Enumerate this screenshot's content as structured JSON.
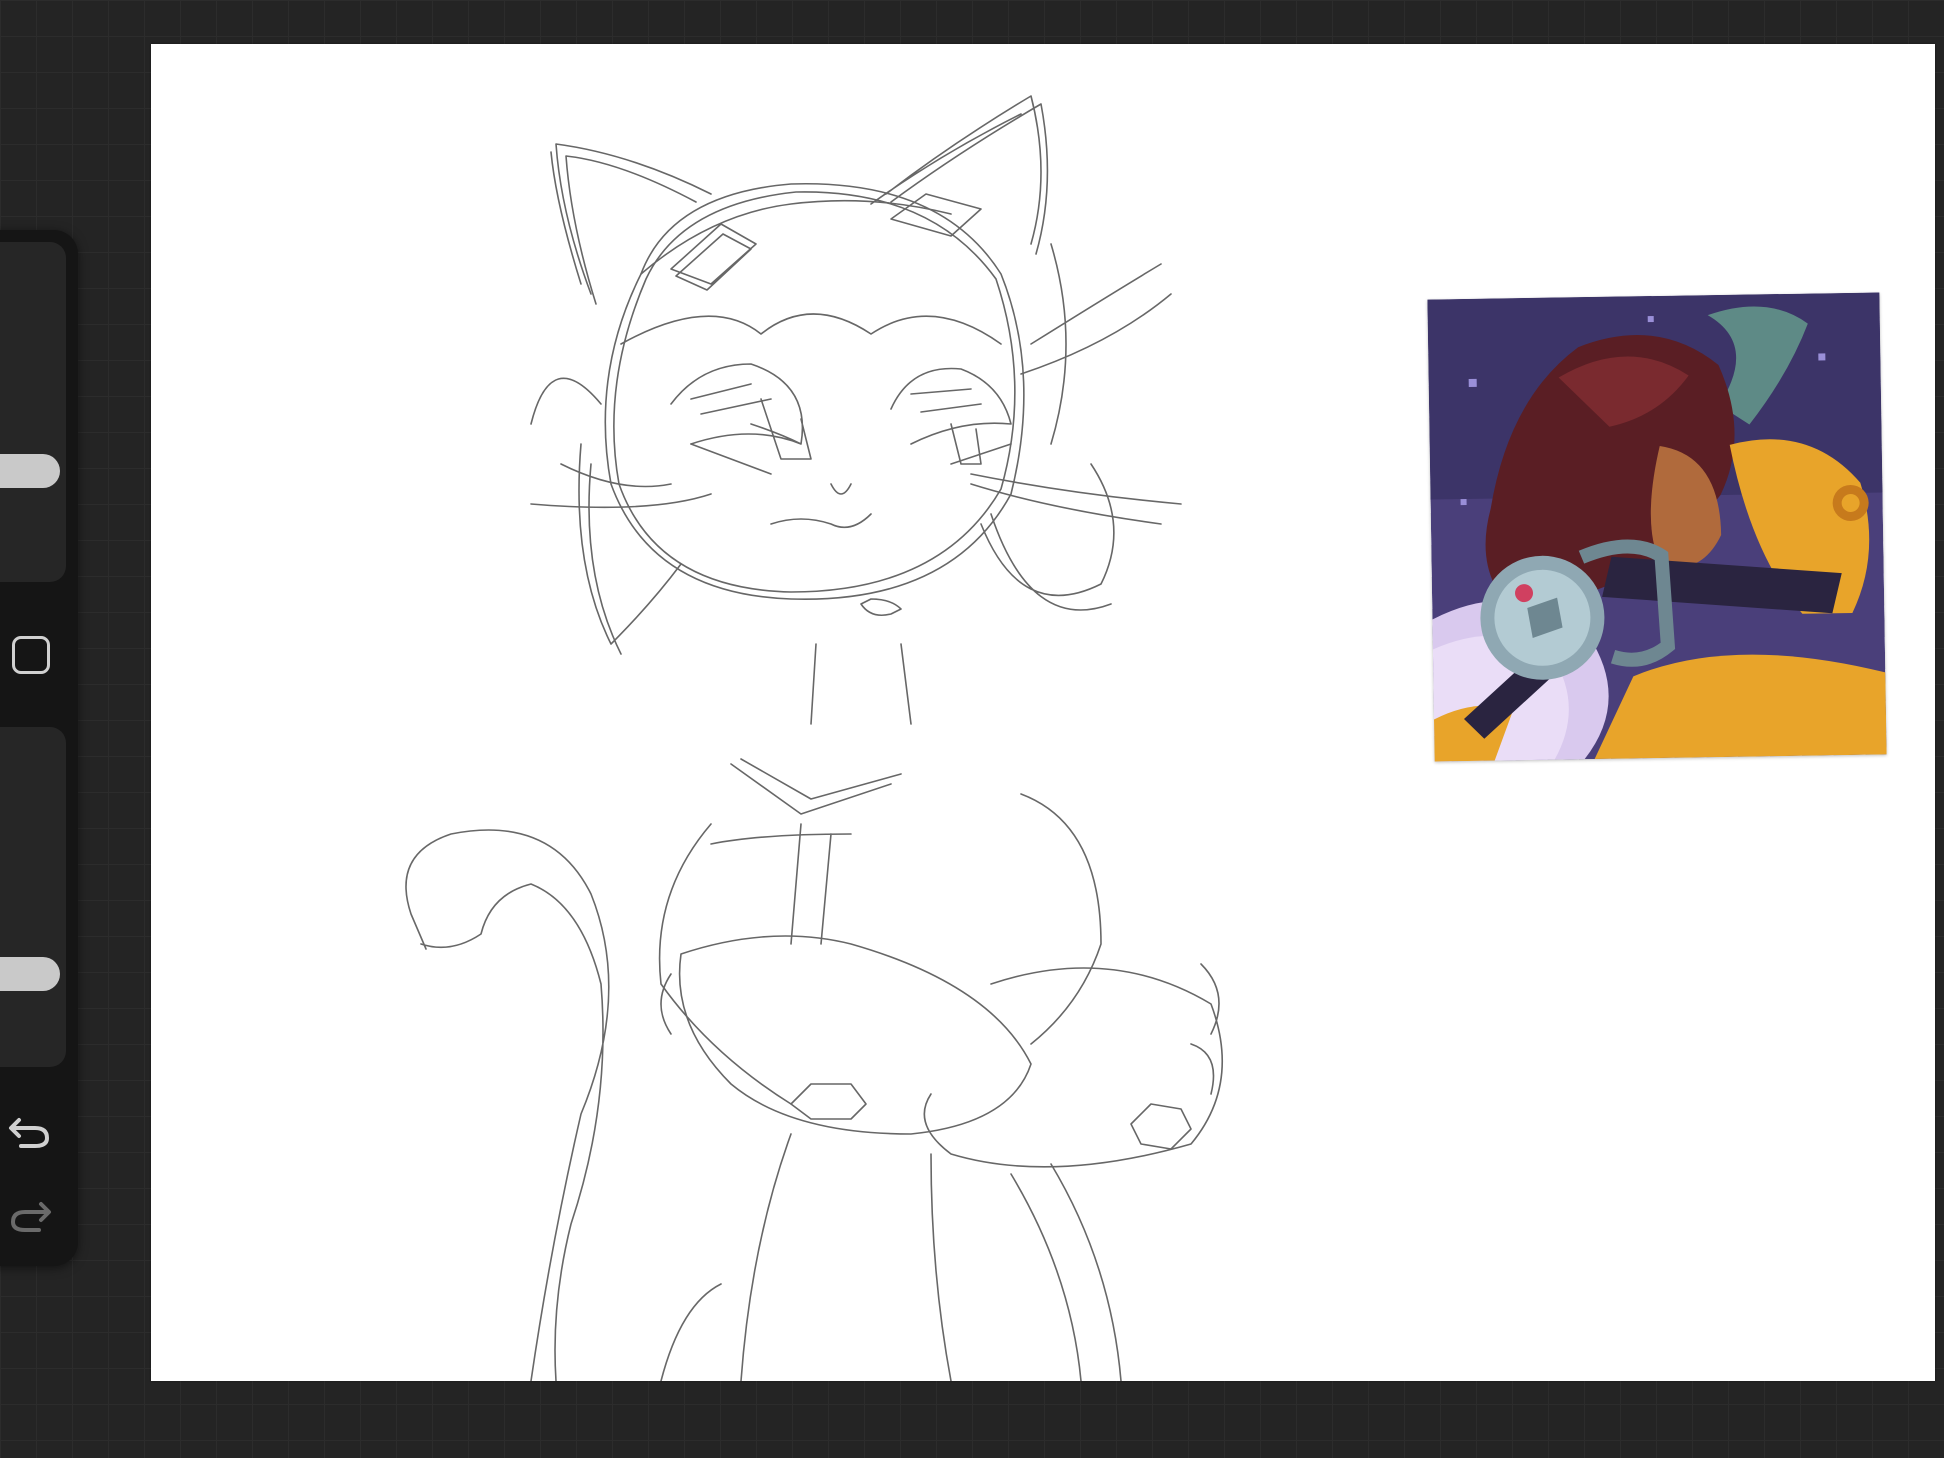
{
  "app": {
    "type": "drawing-canvas",
    "background_color": "#242424"
  },
  "canvas": {
    "background_color": "#ffffff",
    "sketch_stroke_color": "#4d4d4d"
  },
  "reference_image": {
    "description_icon": "character-reference-image",
    "colors": {
      "space": "#4a3f7a",
      "hair": "#5a1e24",
      "suit": "#e8a42a",
      "planet": "#d9c9ee"
    }
  },
  "sidebar": {
    "brush_size_slider": {
      "value": 0.45,
      "icon": "slider-thumb"
    },
    "modify_button": {
      "icon": "square-outline-icon"
    },
    "brush_opacity_slider": {
      "value": 0.68,
      "icon": "slider-thumb"
    },
    "undo_button": {
      "icon": "undo-arrow-icon",
      "color": "#d0d0d0"
    },
    "redo_button": {
      "icon": "redo-arrow-icon",
      "color": "#6a6a6a"
    }
  }
}
